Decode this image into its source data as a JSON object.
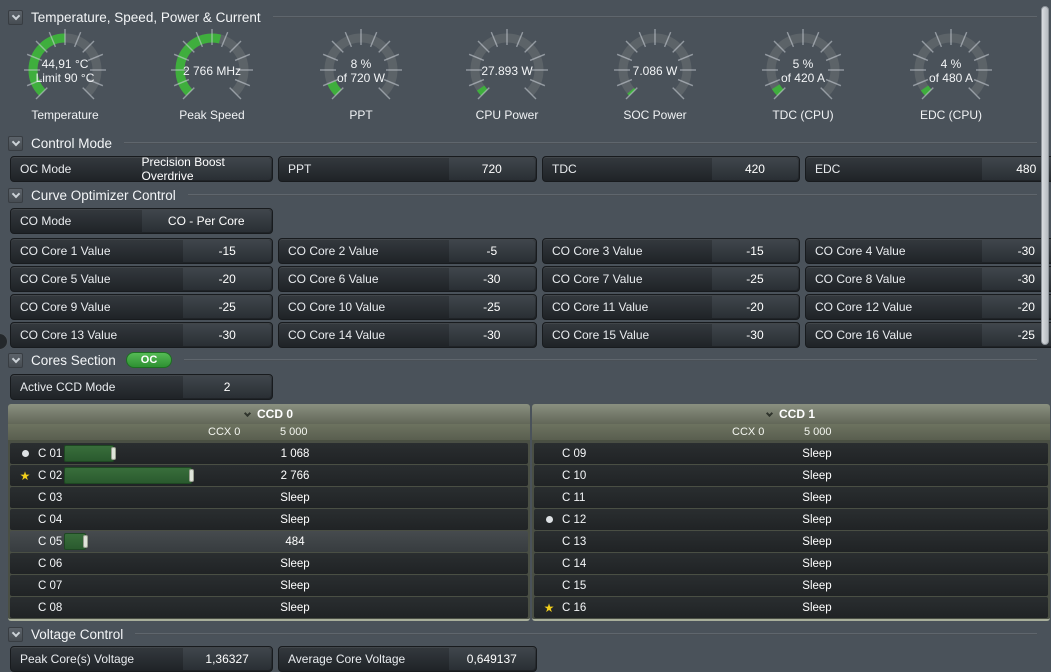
{
  "colors": {
    "accent_green": "#3fae3d",
    "gauge_track": "#5c6368",
    "badge_green": "#3aa23c",
    "bar_green": "#2f6333",
    "star_yellow": "#f2cf1b",
    "handle_gray": "#dfe4da"
  },
  "sections": {
    "gauges": {
      "title": "Temperature, Speed, Power & Current",
      "items": [
        {
          "line1": "44,91 °C",
          "line2": "Limit 90 °C",
          "label": "Temperature",
          "fill": 0.5
        },
        {
          "line1": "2 766  MHz",
          "line2": "",
          "label": "Peak Speed",
          "fill": 0.553
        },
        {
          "line1": "8 %",
          "line2": "of 720 W",
          "label": "PPT",
          "fill": 0.08
        },
        {
          "line1": "27.893 W",
          "line2": "",
          "label": "CPU Power",
          "fill": 0.039
        },
        {
          "line1": "7.086 W",
          "line2": "",
          "label": "SOC Power",
          "fill": 0.017
        },
        {
          "line1": "5 %",
          "line2": "of 420 A",
          "label": "TDC (CPU)",
          "fill": 0.05
        },
        {
          "line1": "4 %",
          "line2": "of 480 A",
          "label": "EDC (CPU)",
          "fill": 0.04
        }
      ]
    },
    "control_mode": {
      "title": "Control Mode",
      "fields": [
        {
          "label": "OC Mode",
          "value": "Precision Boost Overdrive"
        },
        {
          "label": "PPT",
          "value": "720"
        },
        {
          "label": "TDC",
          "value": "420"
        },
        {
          "label": "EDC",
          "value": "480"
        }
      ]
    },
    "curve_optimizer": {
      "title": "Curve Optimizer Control",
      "mode": {
        "label": "CO Mode",
        "value": "CO - Per Core"
      },
      "cores": [
        {
          "label": "CO Core 1 Value",
          "value": "-15"
        },
        {
          "label": "CO Core 2 Value",
          "value": "-5"
        },
        {
          "label": "CO Core 3 Value",
          "value": "-15"
        },
        {
          "label": "CO Core 4 Value",
          "value": "-30"
        },
        {
          "label": "CO Core 5 Value",
          "value": "-20"
        },
        {
          "label": "CO Core 6 Value",
          "value": "-30"
        },
        {
          "label": "CO Core 7 Value",
          "value": "-25"
        },
        {
          "label": "CO Core 8 Value",
          "value": "-30"
        },
        {
          "label": "CO Core 9 Value",
          "value": "-25"
        },
        {
          "label": "CO Core 10 Value",
          "value": "-25"
        },
        {
          "label": "CO Core 11 Value",
          "value": "-20"
        },
        {
          "label": "CO Core 12 Value",
          "value": "-20"
        },
        {
          "label": "CO Core 13 Value",
          "value": "-30"
        },
        {
          "label": "CO Core 14 Value",
          "value": "-30"
        },
        {
          "label": "CO Core 15 Value",
          "value": "-30"
        },
        {
          "label": "CO Core 16 Value",
          "value": "-25"
        }
      ]
    },
    "cores_section": {
      "title": "Cores Section",
      "badge": "OC",
      "ccd_mode": {
        "label": "Active CCD Mode",
        "value": "2"
      },
      "bar_max": 5000,
      "tables": [
        {
          "title": "CCD 0",
          "ccx": "CCX 0",
          "max": "5 000",
          "rows": [
            {
              "label": "C 01",
              "value": "1 068",
              "bar": 1068,
              "icon": "dot"
            },
            {
              "label": "C 02",
              "value": "2 766",
              "bar": 2766,
              "icon": "star"
            },
            {
              "label": "C 03",
              "value": "Sleep"
            },
            {
              "label": "C 04",
              "value": "Sleep"
            },
            {
              "label": "C 05",
              "value": "484",
              "bar": 484,
              "highlight": true
            },
            {
              "label": "C 06",
              "value": "Sleep"
            },
            {
              "label": "C 07",
              "value": "Sleep"
            },
            {
              "label": "C 08",
              "value": "Sleep"
            }
          ]
        },
        {
          "title": "CCD 1",
          "ccx": "CCX 0",
          "max": "5 000",
          "rows": [
            {
              "label": "C 09",
              "value": "Sleep"
            },
            {
              "label": "C 10",
              "value": "Sleep"
            },
            {
              "label": "C 11",
              "value": "Sleep"
            },
            {
              "label": "C 12",
              "value": "Sleep",
              "icon": "dot"
            },
            {
              "label": "C 13",
              "value": "Sleep"
            },
            {
              "label": "C 14",
              "value": "Sleep"
            },
            {
              "label": "C 15",
              "value": "Sleep"
            },
            {
              "label": "C 16",
              "value": "Sleep",
              "icon": "star"
            }
          ]
        }
      ]
    },
    "voltage_control": {
      "title": "Voltage Control",
      "fields": [
        {
          "label": "Peak Core(s) Voltage",
          "value": "1,36327"
        },
        {
          "label": "Average Core Voltage",
          "value": "0,649137"
        }
      ]
    }
  }
}
